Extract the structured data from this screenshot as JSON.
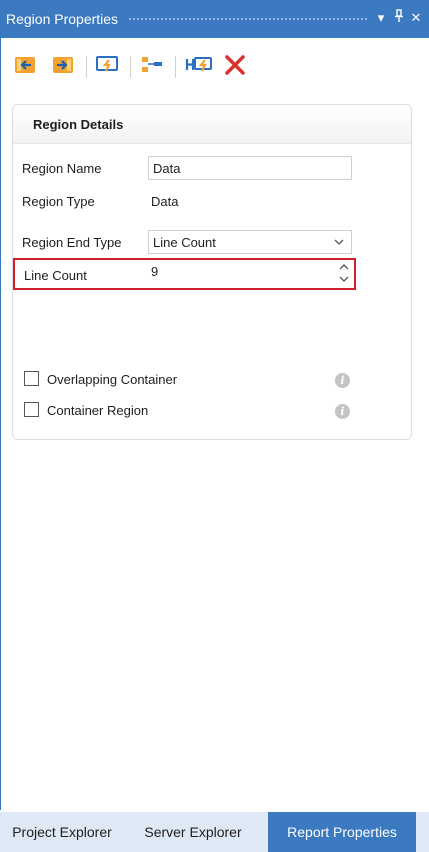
{
  "window": {
    "title": "Region Properties",
    "buttons": {
      "dropdown": "▾",
      "pin": "📌",
      "close": "✕"
    }
  },
  "toolbar": {
    "icons": [
      "move-left-icon",
      "move-right-icon",
      "refresh-region-icon",
      "region-tree-icon",
      "header-lightning-icon",
      "delete-icon"
    ]
  },
  "region_details": {
    "heading": "Region Details",
    "region_name_label": "Region Name",
    "region_name_value": "Data",
    "region_type_label": "Region Type",
    "region_type_value": "Data",
    "region_end_type_label": "Region End Type",
    "region_end_type_value": "Line Count",
    "line_count_label": "Line Count",
    "line_count_value": "9",
    "overlapping_container_label": "Overlapping Container",
    "overlapping_container_checked": false,
    "container_region_label": "Container Region",
    "container_region_checked": false,
    "info_glyph": "i"
  },
  "bottom_tabs": {
    "project_explorer": "Project Explorer",
    "server_explorer": "Server Explorer",
    "report_properties": "Report Properties",
    "active": "report_properties"
  },
  "colors": {
    "accent": "#3b79c0",
    "highlight": "#d0202b",
    "tab_bar": "#dfe9f5"
  }
}
